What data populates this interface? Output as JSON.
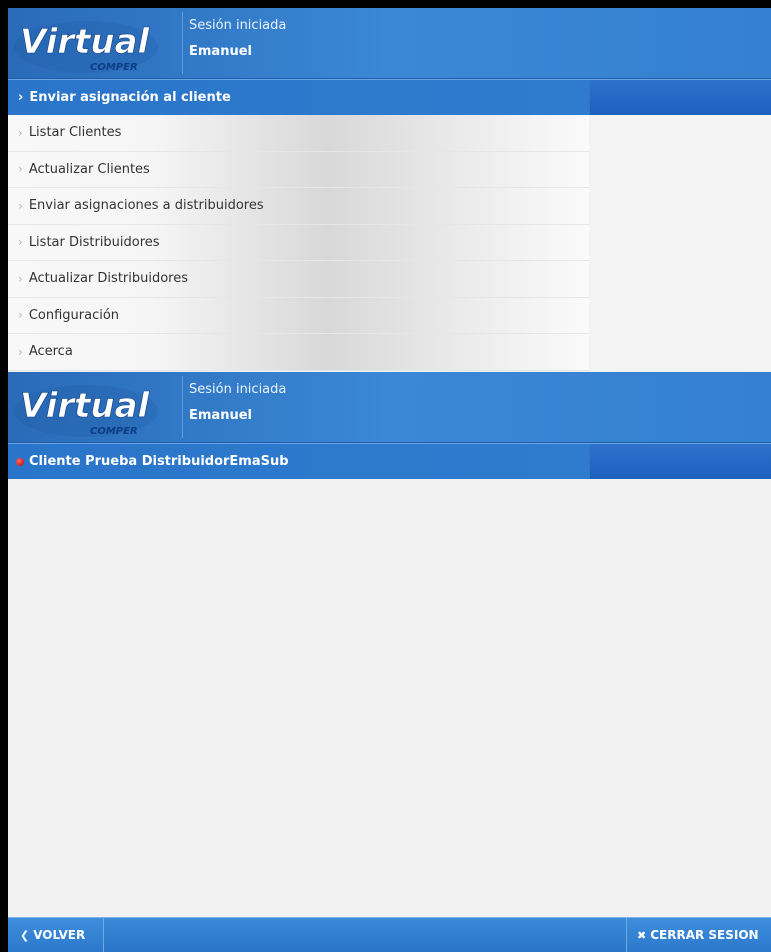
{
  "header": {
    "logo_text": "Virtual",
    "logo_subtext": "COMPER",
    "session_label": "Sesión iniciada",
    "user_name": "Emanuel"
  },
  "menu": {
    "active_item": "Enviar asignación al cliente",
    "items": [
      {
        "label": "Listar Clientes"
      },
      {
        "label": "Actualizar Clientes"
      },
      {
        "label": "Enviar asignaciones a distribuidores"
      },
      {
        "label": "Listar Distribuidores"
      },
      {
        "label": "Actualizar Distribuidores"
      },
      {
        "label": "Configuración"
      },
      {
        "label": "Acerca"
      }
    ]
  },
  "client_view": {
    "client_name": "Cliente Prueba DistribuidorEmaSub",
    "status_color": "#cc0000"
  },
  "footer": {
    "back_label": "VOLVER",
    "logout_label": "CERRAR SESION"
  },
  "icons": {
    "chevron": "chevron-right-icon",
    "back": "chevron-left-icon",
    "close": "close-icon"
  },
  "colors": {
    "header_blue": "#2f7ccf",
    "footer_blue": "#3a8ad8"
  }
}
